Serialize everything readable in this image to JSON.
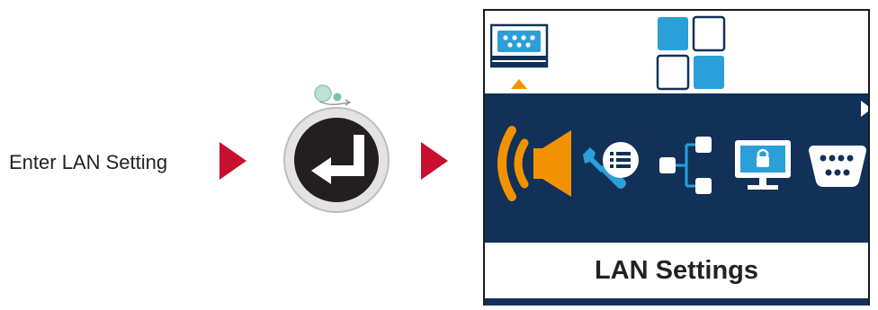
{
  "step": {
    "label": "Enter LAN Setting"
  },
  "screen": {
    "tabs": [
      {
        "icon": "display-settings-icon",
        "selected": true
      },
      {
        "icon": "main-menu-grid-icon",
        "selected": false
      }
    ],
    "menu_icons": [
      {
        "icon": "sound-icon",
        "selected": true
      },
      {
        "icon": "tools-icon",
        "selected": false
      },
      {
        "icon": "network-tree-icon",
        "selected": false
      },
      {
        "icon": "lock-monitor-icon",
        "selected": false
      },
      {
        "icon": "serial-port-icon",
        "selected": false
      }
    ],
    "title": "LAN Settings"
  },
  "colors": {
    "arrow": "#c8102e",
    "navy": "#123158",
    "accent_orange": "#f39200",
    "accent_blue": "#2a9fd8"
  }
}
